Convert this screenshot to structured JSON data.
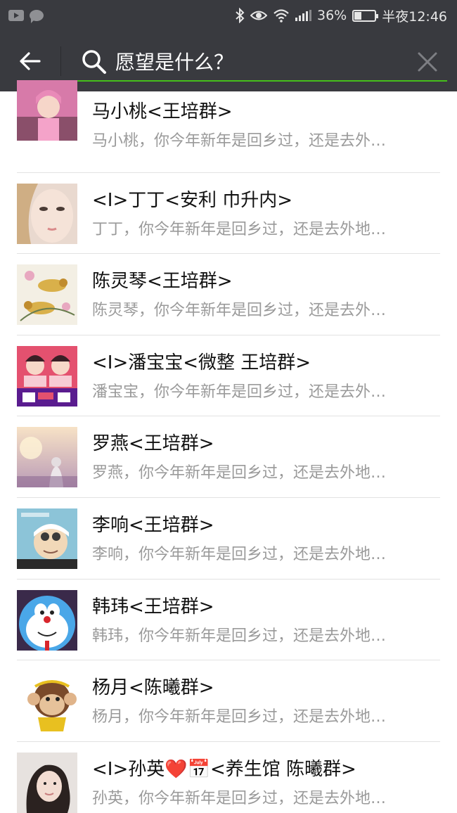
{
  "status_bar": {
    "battery": "36%",
    "battery_level": 0.36,
    "time": "半夜12:46"
  },
  "search": {
    "query": "愿望是什么？"
  },
  "colors": {
    "bar_bg": "#393a3f",
    "accent": "#45c01a"
  },
  "results": [
    {
      "title": "马小桃<王培群>",
      "snippet": "马小桃，你今年新年是回乡过，还是去外…",
      "avatar": "avatar-pink-girl"
    },
    {
      "title": "<I>丁丁<安利 巾升内>",
      "snippet": "丁丁，你今年新年是回乡过，还是去外地…",
      "avatar": "avatar-girl-face"
    },
    {
      "title": "陈灵琴<王培群>",
      "snippet": "陈灵琴，你今年新年是回乡过，还是去外…",
      "avatar": "avatar-birds-painting"
    },
    {
      "title": "<I>潘宝宝<微整 王培群>",
      "snippet": "潘宝宝，你今年新年是回乡过，还是去外…",
      "avatar": "avatar-micro-beauty-poster"
    },
    {
      "title": "罗燕<王培群>",
      "snippet": "罗燕，你今年新年是回乡过，还是去外地…",
      "avatar": "avatar-sunset-girl"
    },
    {
      "title": "李响<王培群>",
      "snippet": "李响，你今年新年是回乡过，还是去外地…",
      "avatar": "avatar-swimmer-cartoon"
    },
    {
      "title": "韩玮<王培群>",
      "snippet": "韩玮，你今年新年是回乡过，还是去外地…",
      "avatar": "avatar-doraemon"
    },
    {
      "title": "杨月<陈曦群>",
      "snippet": "杨月，你今年新年是回乡过，还是去外地…",
      "avatar": "avatar-monkey-cartoon"
    },
    {
      "title": "<I>孙英❤️📅<养生馆 陈曦群>",
      "snippet": "孙英，你今年新年是回乡过，还是去外地…",
      "avatar": "avatar-woman-photo"
    }
  ]
}
